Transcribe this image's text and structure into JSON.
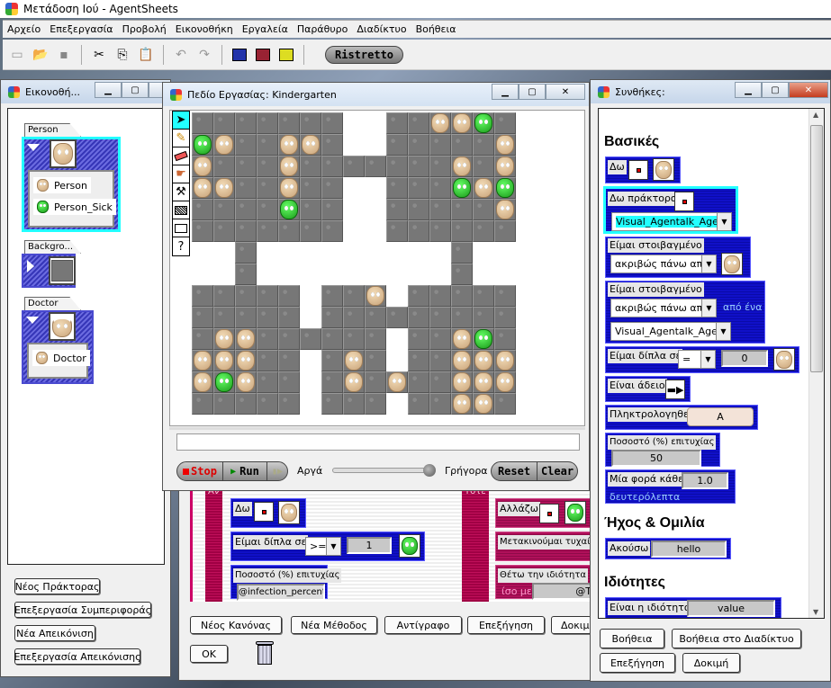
{
  "app": {
    "title": "Μετάδοση Ιού  -  AgentSheets"
  },
  "menu": [
    "Αρχείο",
    "Επεξεργασία",
    "Προβολή",
    "Εικονοθήκη",
    "Εργαλεία",
    "Παράθυρο",
    "Διαδίκτυο",
    "Βοήθεια"
  ],
  "toolbar": {
    "icons": [
      "new-icon",
      "open-folder-icon",
      "save-icon",
      "cut-icon",
      "copy-icon",
      "paste-icon",
      "undo-icon",
      "redo-icon",
      "blue-worksheet-icon",
      "red-worksheet-icon",
      "yellow-worksheet-icon"
    ],
    "ristretto_label": "Ristretto"
  },
  "gallery": {
    "title": "Εικονοθή...",
    "groups": [
      {
        "tab": "Person",
        "expanded": true,
        "selected": true,
        "items": [
          "Person",
          "Person_Sick"
        ]
      },
      {
        "tab": "Backgro...",
        "expanded": false,
        "selected": false,
        "items": []
      },
      {
        "tab": "Doctor",
        "expanded": true,
        "selected": false,
        "items": [
          "Doctor"
        ]
      }
    ],
    "buttons": [
      "Νέος Πράκτορας",
      "Επεξεργασία Συμπεριφοράς",
      "Νέα Απεικόνιση",
      "Επεξεργασία Απεικόνισης"
    ]
  },
  "worksheet": {
    "title": "Πεδίο Εργασίας: Kindergarten",
    "tools": [
      "arrow-tool",
      "pencil-tool",
      "eraser-tool",
      "hand-tool",
      "hammer-tool",
      "pattern-tool",
      "rectangle-tool",
      "help-tool"
    ],
    "grid": {
      "tiles": [
        "#######..######",
        "#######..######",
        "###############",
        "#######..######",
        "#######..######",
        "#######..######",
        "..#.........#..",
        "..#.........#..",
        "#####.###.#####",
        "#####.#########",
        "#########.#####",
        "#####.###.#####",
        "#####.#########",
        "#####.###.#####"
      ],
      "agents": [
        "...........PPS.",
        "SP..PP........P",
        "P...P.......P.P",
        "PP..P.......SPS",
        "....S.........P",
        "...............",
        "...............",
        "...............",
        "........P......",
        "...............",
        ".PP.........PS.",
        "PPP....P....PPP",
        "PSP....P.P..PPP",
        "............PP."
      ],
      "legend": {
        "#": "background-tile",
        "P": "Person",
        "S": "Person_Sick"
      }
    },
    "status_text": "",
    "controls": {
      "stop": "Stop",
      "run": "Run",
      "slow": "Αργά",
      "fast": "Γρήγορα",
      "reset": "Reset",
      "clear": "Clear",
      "speed": 1.0
    }
  },
  "behavior": {
    "if_label": "Αν",
    "then_label": "Τότε",
    "conditions": [
      {
        "label": "Δω",
        "agent": "Person"
      },
      {
        "label": "Είμαι δίπλα σε",
        "operator": ">=",
        "value": "1",
        "agent": "Person_Sick"
      },
      {
        "label": "Ποσοστό (%) επιτυχίας",
        "value": "@infection_percenta"
      }
    ],
    "actions": [
      {
        "label": "Αλλάζω",
        "agent": "Person_Sick"
      },
      {
        "label": "Μετακινούμαι τυχαία"
      },
      {
        "label": "Θέτω την ιδιότητα",
        "equals_label": "ίσο με",
        "value": "@T"
      }
    ],
    "buttons": [
      "Νέος Κανόνας",
      "Νέα Μέθοδος",
      "Αντίγραφο",
      "Επεξήγηση",
      "Δοκιμ"
    ],
    "ok_label": "OK"
  },
  "conditions_palette": {
    "title": "Συνθήκες:",
    "sections": [
      {
        "heading": "Βασικές"
      },
      {
        "heading": "Ήχος & Ομιλία"
      },
      {
        "heading": "Ιδιότητες"
      }
    ],
    "items": {
      "see": "Δω",
      "see_agent": "Δω πράκτορα",
      "see_agent_select": "Visual_Agentalk_Agent",
      "stacked1": "Είμαι στοιβαγμένο",
      "stacked1_select": "ακριβώς πάνω από",
      "stacked2": "Είμαι στοιβαγμένο",
      "stacked2_select": "ακριβώς πάνω από",
      "stacked2_suffix": "από ένα",
      "stacked2_agent": "Visual_Agentalk_Agent",
      "next_to": "Είμαι δίπλα σε",
      "next_to_op": "=",
      "next_to_val": "0",
      "empty": "Είναι άδειο",
      "key": "Πληκτρολογηθεί",
      "key_val": "A",
      "chance": "Ποσοστό (%) επιτυχίας",
      "chance_val": "50",
      "once_every": "Μία φορά κάθε",
      "once_every_val": "1.0",
      "seconds": "δευτερόλεπτα",
      "hear": "Ακούσω",
      "hear_val": "hello",
      "is_property": "Είναι η ιδιότητα",
      "is_property_val": "value"
    },
    "buttons": [
      "Βοήθεια",
      "Βοήθεια στο Διαδίκτυο",
      "Επεξήγηση",
      "Δοκιμή"
    ]
  }
}
